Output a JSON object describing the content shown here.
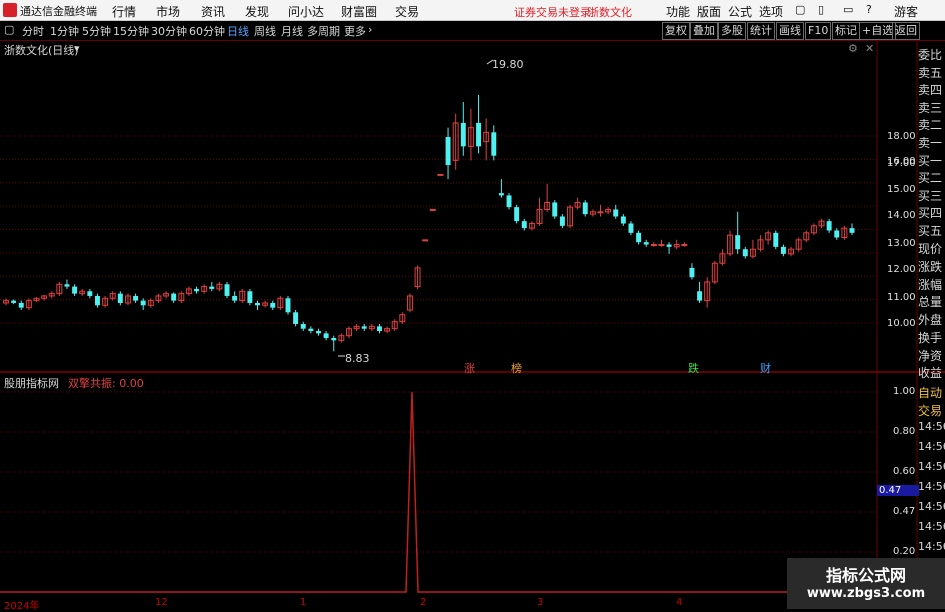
{
  "topbar": {
    "app_name": "通达信金融终端",
    "menus": [
      "行情",
      "市场",
      "资讯",
      "发现",
      "问小达",
      "财富圈",
      "交易"
    ],
    "notice": "证券交易未登录",
    "stock": "浙数文化",
    "right": [
      "功能",
      "版面",
      "公式",
      "选项"
    ],
    "user": "游客"
  },
  "toolbar": {
    "periods": [
      "分时",
      "1分钟",
      "5分钟",
      "15分钟",
      "30分钟",
      "60分钟",
      "日线",
      "周线",
      "月线",
      "多周期",
      "更多"
    ],
    "active": "日线",
    "right_buttons": [
      "复权",
      "叠加",
      "多股",
      "统计",
      "画线",
      "F10",
      "标记",
      "+自选",
      "返回"
    ]
  },
  "main_chart": {
    "title": "浙数文化(日线)",
    "price_axis": [
      "18.00",
      "17.00",
      "16.00",
      "15.00",
      "14.00",
      "13.00",
      "12.00",
      "11.00",
      "10.00"
    ],
    "high_label": "19.80",
    "low_label": "8.83",
    "event_marks": [
      "涨",
      "榜",
      "跌",
      "财"
    ]
  },
  "sub_chart": {
    "title": "股朋指标网",
    "indicator": "双擎共振: 0.00",
    "axis": [
      "1.00",
      "0.80",
      "0.60",
      "0.47",
      "0.20"
    ],
    "current": "0.47"
  },
  "dates": [
    "2024年",
    "12",
    "1",
    "2",
    "3",
    "4"
  ],
  "side_panel": [
    "委比",
    "卖五",
    "卖四",
    "卖三",
    "卖二",
    "卖一",
    "买一",
    "买二",
    "买三",
    "买四",
    "买五",
    "现价",
    "涨跌",
    "涨幅",
    "总量",
    "外盘",
    "换手",
    "净资",
    "收益",
    "自动",
    "交易"
  ],
  "side_times": [
    "14:56",
    "14:56",
    "14:56",
    "14:56",
    "14:56",
    "14:56",
    "14:56"
  ],
  "watermark": {
    "line1": "指标公式网",
    "line2": "www.zbgs3.com"
  },
  "colors": {
    "up": "#e04040",
    "down": "#4ff0f0",
    "grid": "#6a0000"
  },
  "chart_data": {
    "type": "candlestick",
    "candles": [
      {
        "o": 10.9,
        "c": 11.0,
        "h": 11.1,
        "l": 10.8
      },
      {
        "o": 11.0,
        "c": 10.9,
        "h": 11.05,
        "l": 10.85
      },
      {
        "o": 10.9,
        "c": 10.7,
        "h": 11.0,
        "l": 10.6
      },
      {
        "o": 10.7,
        "c": 11.0,
        "h": 11.1,
        "l": 10.6
      },
      {
        "o": 11.0,
        "c": 11.1,
        "h": 11.15,
        "l": 10.95
      },
      {
        "o": 11.1,
        "c": 11.2,
        "h": 11.25,
        "l": 11.0
      },
      {
        "o": 11.2,
        "c": 11.3,
        "h": 11.4,
        "l": 11.1
      },
      {
        "o": 11.3,
        "c": 11.7,
        "h": 11.8,
        "l": 11.2
      },
      {
        "o": 11.7,
        "c": 11.6,
        "h": 11.9,
        "l": 11.5
      },
      {
        "o": 11.6,
        "c": 11.3,
        "h": 11.7,
        "l": 11.2
      },
      {
        "o": 11.3,
        "c": 11.4,
        "h": 11.5,
        "l": 11.2
      },
      {
        "o": 11.4,
        "c": 11.2,
        "h": 11.5,
        "l": 11.1
      },
      {
        "o": 11.2,
        "c": 10.8,
        "h": 11.3,
        "l": 10.7
      },
      {
        "o": 10.8,
        "c": 11.1,
        "h": 11.2,
        "l": 10.7
      },
      {
        "o": 11.1,
        "c": 11.3,
        "h": 11.4,
        "l": 11.0
      },
      {
        "o": 11.3,
        "c": 10.9,
        "h": 11.4,
        "l": 10.8
      },
      {
        "o": 10.9,
        "c": 11.2,
        "h": 11.3,
        "l": 10.8
      },
      {
        "o": 11.2,
        "c": 11.0,
        "h": 11.3,
        "l": 10.9
      },
      {
        "o": 11.0,
        "c": 10.8,
        "h": 11.1,
        "l": 10.6
      },
      {
        "o": 10.8,
        "c": 11.0,
        "h": 11.1,
        "l": 10.7
      },
      {
        "o": 11.0,
        "c": 11.2,
        "h": 11.3,
        "l": 10.9
      },
      {
        "o": 11.2,
        "c": 11.3,
        "h": 11.4,
        "l": 11.1
      },
      {
        "o": 11.3,
        "c": 11.0,
        "h": 11.35,
        "l": 10.9
      },
      {
        "o": 11.0,
        "c": 11.3,
        "h": 11.4,
        "l": 10.9
      },
      {
        "o": 11.3,
        "c": 11.5,
        "h": 11.6,
        "l": 11.2
      },
      {
        "o": 11.5,
        "c": 11.4,
        "h": 11.6,
        "l": 11.3
      },
      {
        "o": 11.4,
        "c": 11.6,
        "h": 11.7,
        "l": 11.3
      },
      {
        "o": 11.6,
        "c": 11.5,
        "h": 11.8,
        "l": 11.4
      },
      {
        "o": 11.5,
        "c": 11.7,
        "h": 11.8,
        "l": 11.4
      },
      {
        "o": 11.7,
        "c": 11.2,
        "h": 11.8,
        "l": 11.1
      },
      {
        "o": 11.2,
        "c": 11.0,
        "h": 11.4,
        "l": 10.9
      },
      {
        "o": 11.0,
        "c": 11.4,
        "h": 11.5,
        "l": 10.9
      },
      {
        "o": 11.4,
        "c": 10.9,
        "h": 11.5,
        "l": 10.8
      },
      {
        "o": 10.9,
        "c": 10.8,
        "h": 11.0,
        "l": 10.6
      },
      {
        "o": 10.8,
        "c": 10.9,
        "h": 11.0,
        "l": 10.7
      },
      {
        "o": 10.9,
        "c": 10.7,
        "h": 11.0,
        "l": 10.6
      },
      {
        "o": 10.7,
        "c": 11.1,
        "h": 11.2,
        "l": 10.6
      },
      {
        "o": 11.1,
        "c": 10.5,
        "h": 11.2,
        "l": 10.4
      },
      {
        "o": 10.5,
        "c": 10.0,
        "h": 10.6,
        "l": 9.9
      },
      {
        "o": 10.0,
        "c": 9.8,
        "h": 10.1,
        "l": 9.7
      },
      {
        "o": 9.8,
        "c": 9.7,
        "h": 9.9,
        "l": 9.6
      },
      {
        "o": 9.7,
        "c": 9.6,
        "h": 9.8,
        "l": 9.5
      },
      {
        "o": 9.6,
        "c": 9.4,
        "h": 9.7,
        "l": 9.3
      },
      {
        "o": 9.4,
        "c": 9.3,
        "h": 9.5,
        "l": 8.83
      },
      {
        "o": 9.3,
        "c": 9.5,
        "h": 9.6,
        "l": 9.2
      },
      {
        "o": 9.5,
        "c": 9.8,
        "h": 9.9,
        "l": 9.4
      },
      {
        "o": 9.8,
        "c": 9.9,
        "h": 10.0,
        "l": 9.7
      },
      {
        "o": 9.9,
        "c": 9.8,
        "h": 10.0,
        "l": 9.7
      },
      {
        "o": 9.8,
        "c": 9.9,
        "h": 10.0,
        "l": 9.7
      },
      {
        "o": 9.9,
        "c": 9.7,
        "h": 10.0,
        "l": 9.6
      },
      {
        "o": 9.7,
        "c": 9.8,
        "h": 9.9,
        "l": 9.6
      },
      {
        "o": 9.8,
        "c": 10.1,
        "h": 10.2,
        "l": 9.7
      },
      {
        "o": 10.1,
        "c": 10.4,
        "h": 10.5,
        "l": 10.0
      },
      {
        "o": 10.6,
        "c": 11.2,
        "h": 11.3,
        "l": 10.5
      },
      {
        "o": 11.6,
        "c": 12.4,
        "h": 12.5,
        "l": 11.5
      },
      {
        "o": 13.6,
        "c": 13.6,
        "h": 13.6,
        "l": 13.6
      },
      {
        "o": 14.9,
        "c": 14.9,
        "h": 14.9,
        "l": 14.9
      },
      {
        "o": 16.4,
        "c": 16.4,
        "h": 16.4,
        "l": 16.4
      },
      {
        "o": 18.0,
        "c": 16.8,
        "h": 18.4,
        "l": 16.2
      },
      {
        "o": 17.0,
        "c": 18.6,
        "h": 19.0,
        "l": 16.6
      },
      {
        "o": 18.6,
        "c": 17.6,
        "h": 19.5,
        "l": 17.2
      },
      {
        "o": 17.6,
        "c": 18.4,
        "h": 19.2,
        "l": 17.0
      },
      {
        "o": 18.6,
        "c": 17.6,
        "h": 19.8,
        "l": 17.3
      },
      {
        "o": 17.8,
        "c": 18.2,
        "h": 18.8,
        "l": 17.0
      },
      {
        "o": 18.2,
        "c": 17.2,
        "h": 18.5,
        "l": 17.0
      },
      {
        "o": 15.6,
        "c": 15.5,
        "h": 16.2,
        "l": 15.4
      },
      {
        "o": 15.5,
        "c": 15.0,
        "h": 15.6,
        "l": 14.9
      },
      {
        "o": 15.0,
        "c": 14.4,
        "h": 15.1,
        "l": 14.3
      },
      {
        "o": 14.4,
        "c": 14.1,
        "h": 14.5,
        "l": 14.0
      },
      {
        "o": 14.1,
        "c": 14.3,
        "h": 14.4,
        "l": 14.0
      },
      {
        "o": 14.3,
        "c": 14.9,
        "h": 15.4,
        "l": 14.2
      },
      {
        "o": 14.9,
        "c": 15.2,
        "h": 16.0,
        "l": 14.8
      },
      {
        "o": 15.2,
        "c": 14.6,
        "h": 15.3,
        "l": 14.5
      },
      {
        "o": 14.6,
        "c": 14.2,
        "h": 14.7,
        "l": 14.1
      },
      {
        "o": 14.2,
        "c": 15.0,
        "h": 15.1,
        "l": 14.1
      },
      {
        "o": 15.0,
        "c": 15.2,
        "h": 15.4,
        "l": 14.9
      },
      {
        "o": 15.2,
        "c": 14.7,
        "h": 15.3,
        "l": 14.6
      },
      {
        "o": 14.7,
        "c": 14.8,
        "h": 14.9,
        "l": 14.6
      },
      {
        "o": 14.8,
        "c": 14.8,
        "h": 15.1,
        "l": 14.6
      },
      {
        "o": 14.8,
        "c": 14.9,
        "h": 15.0,
        "l": 14.7
      },
      {
        "o": 14.9,
        "c": 14.6,
        "h": 15.1,
        "l": 14.5
      },
      {
        "o": 14.6,
        "c": 14.3,
        "h": 14.7,
        "l": 14.2
      },
      {
        "o": 14.3,
        "c": 13.9,
        "h": 14.4,
        "l": 13.8
      },
      {
        "o": 13.9,
        "c": 13.5,
        "h": 14.0,
        "l": 13.4
      },
      {
        "o": 13.5,
        "c": 13.4,
        "h": 13.6,
        "l": 13.3
      },
      {
        "o": 13.4,
        "c": 13.4,
        "h": 13.5,
        "l": 13.3
      },
      {
        "o": 13.4,
        "c": 13.4,
        "h": 13.6,
        "l": 13.3
      },
      {
        "o": 13.4,
        "c": 13.3,
        "h": 13.5,
        "l": 13.0
      },
      {
        "o": 13.3,
        "c": 13.4,
        "h": 13.6,
        "l": 13.2
      },
      {
        "o": 13.4,
        "c": 13.4,
        "h": 13.5,
        "l": 13.3
      },
      {
        "o": 12.4,
        "c": 12.0,
        "h": 12.6,
        "l": 11.9
      },
      {
        "o": 11.4,
        "c": 11.0,
        "h": 11.8,
        "l": 10.9
      },
      {
        "o": 11.0,
        "c": 11.8,
        "h": 12.0,
        "l": 10.7
      },
      {
        "o": 11.8,
        "c": 12.6,
        "h": 12.7,
        "l": 11.7
      },
      {
        "o": 12.6,
        "c": 13.0,
        "h": 13.2,
        "l": 12.5
      },
      {
        "o": 13.0,
        "c": 13.8,
        "h": 14.0,
        "l": 12.9
      },
      {
        "o": 13.8,
        "c": 13.2,
        "h": 14.8,
        "l": 13.0
      },
      {
        "o": 13.2,
        "c": 12.9,
        "h": 13.3,
        "l": 12.8
      },
      {
        "o": 12.9,
        "c": 13.2,
        "h": 13.6,
        "l": 12.8
      },
      {
        "o": 13.2,
        "c": 13.6,
        "h": 13.8,
        "l": 13.1
      },
      {
        "o": 13.6,
        "c": 13.9,
        "h": 14.0,
        "l": 13.4
      },
      {
        "o": 13.9,
        "c": 13.3,
        "h": 14.0,
        "l": 13.2
      },
      {
        "o": 13.3,
        "c": 13.0,
        "h": 13.4,
        "l": 12.9
      },
      {
        "o": 13.0,
        "c": 13.2,
        "h": 13.3,
        "l": 12.9
      },
      {
        "o": 13.2,
        "c": 13.6,
        "h": 13.7,
        "l": 13.1
      },
      {
        "o": 13.6,
        "c": 13.9,
        "h": 14.0,
        "l": 13.5
      },
      {
        "o": 13.9,
        "c": 14.2,
        "h": 14.3,
        "l": 13.8
      },
      {
        "o": 14.2,
        "c": 14.4,
        "h": 14.5,
        "l": 14.1
      },
      {
        "o": 14.4,
        "c": 14.0,
        "h": 14.5,
        "l": 13.9
      },
      {
        "o": 14.0,
        "c": 13.7,
        "h": 14.1,
        "l": 13.6
      },
      {
        "o": 13.7,
        "c": 14.1,
        "h": 14.2,
        "l": 13.6
      },
      {
        "o": 14.1,
        "c": 13.9,
        "h": 14.3,
        "l": 13.8
      }
    ],
    "indicator_values_note": "single spike",
    "indicator": {
      "peak_index": 53,
      "peak": 1.0,
      "baseline": 0.0
    },
    "ylim": [
      8.5,
      20.5
    ]
  }
}
